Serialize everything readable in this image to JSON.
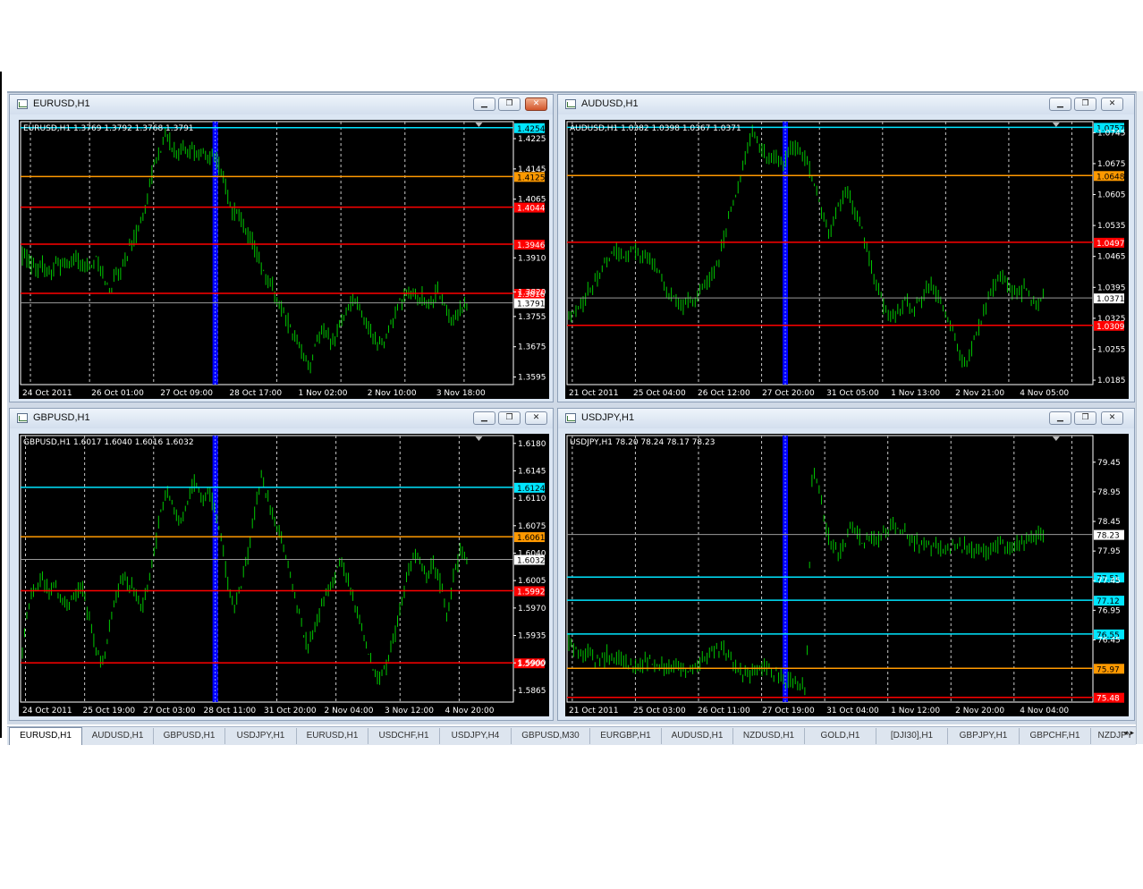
{
  "tabs": [
    {
      "label": "EURUSD,H1",
      "active": true
    },
    {
      "label": "AUDUSD,H1"
    },
    {
      "label": "GBPUSD,H1"
    },
    {
      "label": "USDJPY,H1"
    },
    {
      "label": "EURUSD,H1"
    },
    {
      "label": "USDCHF,H1"
    },
    {
      "label": "USDJPY,H4"
    },
    {
      "label": "GBPUSD,M30"
    },
    {
      "label": "EURGBP,H1"
    },
    {
      "label": "AUDUSD,H1"
    },
    {
      "label": "NZDUSD,H1"
    },
    {
      "label": "GOLD,H1"
    },
    {
      "label": "[DJI30],H1"
    },
    {
      "label": "GBPJPY,H1"
    },
    {
      "label": "GBPCHF,H1"
    },
    {
      "label": "NZDJPY"
    }
  ],
  "tab_arrows": "◂ ▸",
  "windows": [
    {
      "title": "EURUSD,H1",
      "info": "EURUSD,H1  1.3769 1.3792 1.3768 1.3791",
      "close_active": true,
      "chart_data": {
        "type": "candlestick",
        "ylim": [
          1.3575,
          1.427
        ],
        "yticks": [
          "1.4225",
          "1.4145",
          "1.4065",
          "1.3910",
          "1.3820",
          "1.3755",
          "1.3675",
          "1.3595"
        ],
        "xticks": [
          "24 Oct 2011",
          "26 Oct 01:00",
          "27 Oct 09:00",
          "28 Oct 17:00",
          "1 Nov 02:00",
          "2 Nov 10:00",
          "3 Nov 18:00"
        ],
        "current_price": "1.3791",
        "levels": [
          {
            "price": 1.4254,
            "label": "1.4254",
            "color": "#00e5ff"
          },
          {
            "price": 1.4125,
            "label": "1.4125",
            "color": "#ff9900"
          },
          {
            "price": 1.4044,
            "label": "1.4044",
            "color": "#ff0000"
          },
          {
            "price": 1.3946,
            "label": "1.3946",
            "color": "#ff0000"
          },
          {
            "price": 1.3816,
            "label": "1.3816",
            "color": "#ff0000"
          }
        ],
        "path": [
          1.392,
          1.3905,
          1.389,
          1.388,
          1.3895,
          1.387,
          1.3865,
          1.39,
          1.388,
          1.3895,
          1.39,
          1.391,
          1.388,
          1.39,
          1.389,
          1.3905,
          1.388,
          1.385,
          1.382,
          1.388,
          1.387,
          1.39,
          1.394,
          1.396,
          1.4,
          1.403,
          1.41,
          1.416,
          1.418,
          1.424,
          1.422,
          1.42,
          1.419,
          1.42,
          1.4185,
          1.4195,
          1.418,
          1.419,
          1.417,
          1.418,
          1.416,
          1.413,
          1.408,
          1.403,
          1.404,
          1.401,
          1.398,
          1.396,
          1.392,
          1.388,
          1.385,
          1.384,
          1.38,
          1.378,
          1.375,
          1.372,
          1.369,
          1.366,
          1.364,
          1.362,
          1.368,
          1.37,
          1.372,
          1.369,
          1.37,
          1.374,
          1.376,
          1.378,
          1.38,
          1.378,
          1.375,
          1.372,
          1.37,
          1.369,
          1.368,
          1.372,
          1.374,
          1.378,
          1.38,
          1.382,
          1.381,
          1.38,
          1.381,
          1.379,
          1.38,
          1.382,
          1.38,
          1.376,
          1.374,
          1.377,
          1.378,
          1.3791
        ],
        "marker_x": 0.395,
        "grid_x": [
          0.02,
          0.14,
          0.27,
          0.4,
          0.52,
          0.65,
          0.78,
          0.9
        ]
      }
    },
    {
      "title": "AUDUSD,H1",
      "info": "AUDUSD,H1  1.0382 1.0398 1.0367 1.0371",
      "close_active": false,
      "chart_data": {
        "type": "candlestick",
        "ylim": [
          1.0175,
          1.077
        ],
        "yticks": [
          "1.0745",
          "1.0675",
          "1.0605",
          "1.0535",
          "1.0465",
          "1.0395",
          "1.0325",
          "1.0255",
          "1.0185"
        ],
        "xticks": [
          "21 Oct 2011",
          "25 Oct 04:00",
          "26 Oct 12:00",
          "27 Oct 20:00",
          "31 Oct 05:00",
          "1 Nov 13:00",
          "2 Nov 21:00",
          "4 Nov 05:00"
        ],
        "current_price": "1.0371",
        "levels": [
          {
            "price": 1.0757,
            "label": "1.0757",
            "color": "#00e5ff"
          },
          {
            "price": 1.0648,
            "label": "1.0648",
            "color": "#ff9900"
          },
          {
            "price": 1.0497,
            "label": "1.0497",
            "color": "#ff0000"
          },
          {
            "price": 1.0309,
            "label": "1.0309",
            "color": "#ff0000"
          }
        ],
        "path": [
          1.034,
          1.033,
          1.035,
          1.038,
          1.04,
          1.042,
          1.045,
          1.047,
          1.048,
          1.046,
          1.047,
          1.048,
          1.047,
          1.046,
          1.045,
          1.043,
          1.04,
          1.038,
          1.036,
          1.035,
          1.037,
          1.036,
          1.038,
          1.04,
          1.042,
          1.045,
          1.05,
          1.055,
          1.06,
          1.065,
          1.07,
          1.074,
          1.072,
          1.07,
          1.068,
          1.069,
          1.067,
          1.07,
          1.072,
          1.07,
          1.068,
          1.065,
          1.06,
          1.055,
          1.052,
          1.056,
          1.059,
          1.061,
          1.058,
          1.054,
          1.049,
          1.044,
          1.04,
          1.036,
          1.032,
          1.033,
          1.035,
          1.037,
          1.034,
          1.036,
          1.038,
          1.04,
          1.038,
          1.035,
          1.032,
          1.028,
          1.024,
          1.022,
          1.026,
          1.03,
          1.034,
          1.038,
          1.04,
          1.042,
          1.04,
          1.039,
          1.038,
          1.04,
          1.037,
          1.035,
          1.0371
        ],
        "marker_x": 0.415,
        "grid_x": [
          0.01,
          0.13,
          0.25,
          0.37,
          0.48,
          0.6,
          0.72,
          0.84,
          0.96
        ]
      }
    },
    {
      "title": "GBPUSD,H1",
      "info": "GBPUSD,H1  1.6017 1.6040 1.6016 1.6032",
      "close_active": false,
      "chart_data": {
        "type": "candlestick",
        "ylim": [
          1.585,
          1.619
        ],
        "yticks": [
          "1.6180",
          "1.6145",
          "1.6110",
          "1.6075",
          "1.6040",
          "1.6005",
          "1.5970",
          "1.5935",
          "1.5900",
          "1.5865"
        ],
        "xticks": [
          "24 Oct 2011",
          "25 Oct 19:00",
          "27 Oct 03:00",
          "28 Oct 11:00",
          "31 Oct 20:00",
          "2 Nov 04:00",
          "3 Nov 12:00",
          "4 Nov 20:00"
        ],
        "current_price": "1.6032",
        "levels": [
          {
            "price": 1.6124,
            "label": "1.6124",
            "color": "#00e5ff"
          },
          {
            "price": 1.6061,
            "label": "1.6061",
            "color": "#ff9900"
          },
          {
            "price": 1.5992,
            "label": "1.5992",
            "color": "#ff0000"
          },
          {
            "price": 1.59,
            "label": "1.5900",
            "color": "#ff0000"
          }
        ],
        "path": [
          1.592,
          1.598,
          1.6,
          1.601,
          1.599,
          1.6,
          1.598,
          1.597,
          1.599,
          1.6,
          1.596,
          1.592,
          1.59,
          1.594,
          1.598,
          1.601,
          1.6,
          1.599,
          1.597,
          1.6,
          1.605,
          1.61,
          1.612,
          1.609,
          1.608,
          1.611,
          1.613,
          1.611,
          1.612,
          1.61,
          1.606,
          1.6,
          1.597,
          1.6,
          1.604,
          1.609,
          1.614,
          1.611,
          1.608,
          1.606,
          1.603,
          1.599,
          1.595,
          1.592,
          1.594,
          1.597,
          1.599,
          1.601,
          1.603,
          1.601,
          1.598,
          1.595,
          1.592,
          1.589,
          1.588,
          1.59,
          1.593,
          1.597,
          1.601,
          1.604,
          1.603,
          1.601,
          1.603,
          1.6,
          1.596,
          1.601,
          1.604,
          1.6032
        ],
        "marker_x": 0.395,
        "grid_x": [
          0.01,
          0.13,
          0.27,
          0.4,
          0.52,
          0.64,
          0.77,
          0.89
        ]
      }
    },
    {
      "title": "USDJPY,H1",
      "info": "USDJPY,H1  78.20 78.24 78.17 78.23",
      "close_active": false,
      "chart_data": {
        "type": "candlestick",
        "ylim": [
          75.4,
          79.9
        ],
        "yticks": [
          "79.45",
          "78.95",
          "78.45",
          "77.95",
          "77.45",
          "76.95",
          "76.45"
        ],
        "xticks": [
          "21 Oct 2011",
          "25 Oct 03:00",
          "26 Oct 11:00",
          "27 Oct 19:00",
          "31 Oct 04:00",
          "1 Nov 12:00",
          "2 Nov 20:00",
          "4 Nov 04:00"
        ],
        "current_price": "78.23",
        "levels": [
          {
            "price": 77.51,
            "label": "77.51",
            "color": "#00e5ff"
          },
          {
            "price": 77.12,
            "label": "77.12",
            "color": "#00e5ff"
          },
          {
            "price": 76.55,
            "label": "76.55",
            "color": "#00e5ff"
          },
          {
            "price": 75.97,
            "label": "75.97",
            "color": "#ff9900"
          },
          {
            "price": 75.48,
            "label": "75.48",
            "color": "#ff0000"
          }
        ],
        "path": [
          76.4,
          76.3,
          76.2,
          76.25,
          76.15,
          76.1,
          76.2,
          76.15,
          76.1,
          76.05,
          75.95,
          76.0,
          76.1,
          76.05,
          76.0,
          75.95,
          76.0,
          76.05,
          75.95,
          75.9,
          76.0,
          76.1,
          76.2,
          76.35,
          76.3,
          76.2,
          76.0,
          75.9,
          75.85,
          75.95,
          76.0,
          75.95,
          75.9,
          75.85,
          75.8,
          75.75,
          75.7,
          75.6,
          79.4,
          79.0,
          78.4,
          78.0,
          77.95,
          78.05,
          78.4,
          78.2,
          78.1,
          78.2,
          78.1,
          78.25,
          78.3,
          78.4,
          78.3,
          78.2,
          78.1,
          78.05,
          78.0,
          78.05,
          78.0,
          77.95,
          78.0,
          78.05,
          78.0,
          77.95,
          77.98,
          77.95,
          78.0,
          78.05,
          78.0,
          78.05,
          78.1,
          78.05,
          78.15,
          78.2,
          78.23
        ],
        "marker_x": 0.415,
        "grid_x": [
          0.01,
          0.13,
          0.25,
          0.37,
          0.49,
          0.61,
          0.73,
          0.85,
          0.96
        ]
      }
    }
  ]
}
